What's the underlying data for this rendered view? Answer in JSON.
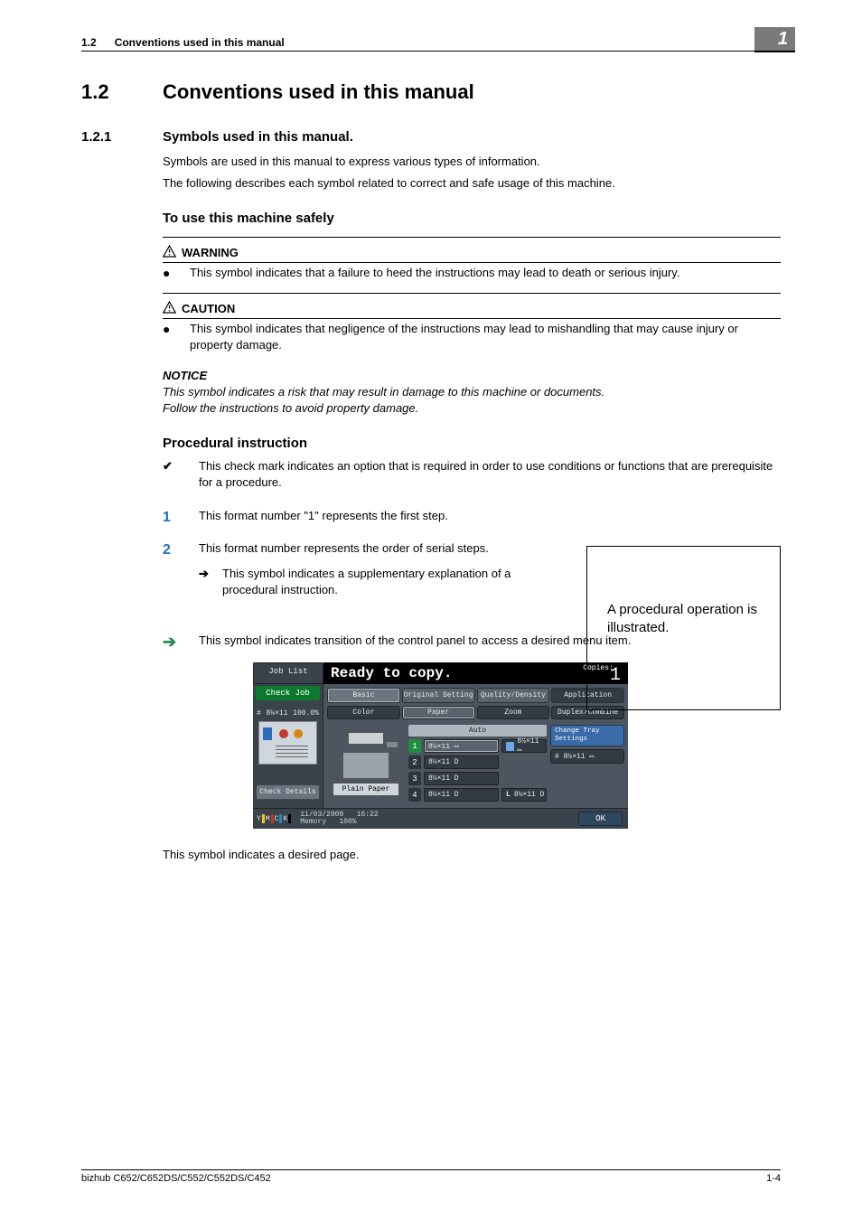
{
  "header": {
    "section_no": "1.2",
    "section_title": "Conventions used in this manual",
    "chapter_no": "1"
  },
  "h1": {
    "num": "1.2",
    "title": "Conventions used in this manual"
  },
  "h2": {
    "num": "1.2.1",
    "title": "Symbols used in this manual."
  },
  "intro1": "Symbols are used in this manual to express various types of information.",
  "intro2": "The following describes each symbol related to correct and safe usage of this machine.",
  "safely_title": "To use this machine safely",
  "warning": {
    "label": "WARNING",
    "text": "This symbol indicates that a failure to heed the instructions may lead to death or serious injury."
  },
  "caution": {
    "label": "CAUTION",
    "text": "This symbol indicates that negligence of the instructions may lead to mishandling that may cause injury or property damage."
  },
  "notice": {
    "label": "NOTICE",
    "line1": "This symbol indicates a risk that may result in damage to this machine or documents.",
    "line2": "Follow the instructions to avoid property damage."
  },
  "procedural_title": "Procedural instruction",
  "check_text": "This check mark indicates an option that is required in order to use conditions or functions that are prerequisite for a procedure.",
  "step1_mark": "1",
  "step1_text": "This format number \"1\" represents the first step.",
  "step2_mark": "2",
  "step2_text": "This format number represents the order of serial steps.",
  "sub_arrow_text": "This symbol indicates a supplementary explanation of a procedural instruction.",
  "illus_box": "A procedural operation is illustrated.",
  "menu_arrow_text": "This symbol indicates transition of the control panel to access a desired menu item.",
  "panel": {
    "job_list": "Job List",
    "ready": "Ready to copy.",
    "copies_label": "Copies:",
    "copies_value": "1",
    "check_job": "Check Job",
    "status_size": "8½×11",
    "status_pct": "100.0%",
    "check_details": "Check Details",
    "tabs": [
      "Basic",
      "Original Setting",
      "Quality/Density",
      "Application"
    ],
    "subtabs": [
      "Color",
      "Paper",
      "Zoom",
      "Duplex/Combine"
    ],
    "auto": "Auto",
    "plain": "Plain Paper",
    "trays": [
      {
        "n": "1",
        "label": "8½×11 ▭",
        "sel": true,
        "side": "8½×11 ▭"
      },
      {
        "n": "2",
        "label": "8½×11 D",
        "sel": false,
        "side": ""
      },
      {
        "n": "3",
        "label": "8½×11 D",
        "sel": false,
        "side": ""
      },
      {
        "n": "4",
        "label": "8½×11 D",
        "sel": false,
        "side": "8½×11 D"
      }
    ],
    "side_L": "L",
    "change_tray": "Change Tray Settings",
    "change_size": "# 8½×11 ▭",
    "ymck": [
      "Y",
      "M",
      "C",
      "K"
    ],
    "foot_date": "11/03/2008",
    "foot_time": "16:22",
    "foot_mem_label": "Memory",
    "foot_mem_val": "100%",
    "ok": "OK"
  },
  "closing": "This symbol indicates a desired page.",
  "footer": {
    "left": "bizhub C652/C652DS/C552/C552DS/C452",
    "right": "1-4"
  }
}
